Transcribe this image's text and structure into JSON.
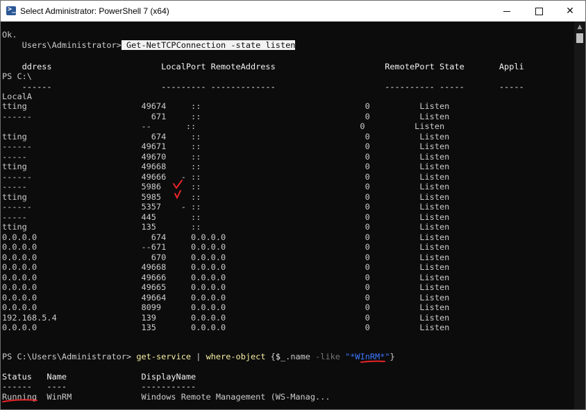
{
  "window": {
    "title": "Select Administrator: PowerShell 7 (x64)",
    "icon": "powershell-icon",
    "controls": {
      "minimize_glyph": "",
      "maximize_glyph": "",
      "close_glyph": "✕"
    }
  },
  "console": {
    "line_00": "Ok.",
    "line_01": {
      "prompt": "    Users\\Administrator>",
      "cmd": "Get-NetTCPConnection",
      "param": "-state",
      "arg": "listen"
    },
    "line_02": "    ddress                      LocalPort RemoteAddress                      RemotePort State       Appli",
    "line_03": "PS C:\\",
    "line_04": "    ------                      --------- -------------                      ---------- -----       -----",
    "line_05": "LocalA",
    "rows": [
      "tting                       49674     ::                                 0          Listen",
      "------                        671     ::                                 0          Listen",
      "                            --       ::                                 0          Listen",
      "tting                         674     ::                                 0          Listen",
      "------                      49671     ::                                 0          Listen",
      "-----                       49670     ::                                 0          Listen",
      "tting                       49668     ::                                 0          Listen",
      "------                      49666   - ::                                 0          Listen",
      "-----                       5986      ::                                 0          Listen",
      "tting                       5985      ::                                 0          Listen",
      "------                      5357    - ::                                 0          Listen",
      "-----                       445       ::                                 0          Listen",
      "tting                       135       ::                                 0          Listen",
      "0.0.0.0                       674     0.0.0.0                            0          Listen",
      "0.0.0.0                     --671     0.0.0.0                            0          Listen",
      "0.0.0.0                       670     0.0.0.0                            0          Listen",
      "0.0.0.0                     49668     0.0.0.0                            0          Listen",
      "0.0.0.0                     49666     0.0.0.0                            0          Listen",
      "0.0.0.0                     49665     0.0.0.0                            0          Listen",
      "0.0.0.0                     49664     0.0.0.0                            0          Listen",
      "0.0.0.0                     8099      0.0.0.0                            0          Listen",
      "192.168.5.4                 139       0.0.0.0                            0          Listen",
      "0.0.0.0                     135       0.0.0.0                            0          Listen"
    ],
    "line_gs": {
      "prompt": "PS C:\\Users\\Administrator>",
      "cmd": "get-service",
      "pipe": "|",
      "where": "where-object",
      "brace_open": "{",
      "var": "$_",
      "prop": ".name",
      "op": "-like",
      "str": "\"*WInRM*\"",
      "brace_close": "}"
    },
    "svc_header": "Status   Name               DisplayName",
    "svc_dashes": "------   ----               -----------",
    "svc_row": "Running  WinRM              Windows Remote Management (WS-Manag..."
  },
  "annotations": {
    "color": "#e8242a",
    "checkmarks": [
      "checkmark-5986",
      "checkmark-5985"
    ],
    "underlines": [
      "underline-winrm",
      "underline-running"
    ]
  }
}
